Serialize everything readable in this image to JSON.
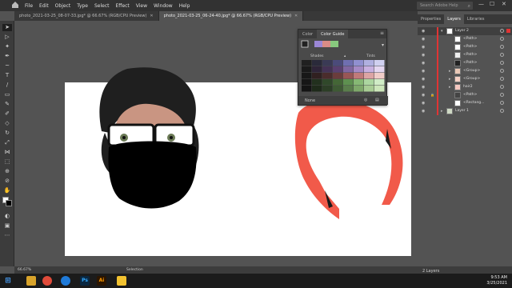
{
  "menubar": {
    "items": [
      "File",
      "Edit",
      "Object",
      "Type",
      "Select",
      "Effect",
      "View",
      "Window",
      "Help"
    ],
    "search_placeholder": "Search Adobe Help"
  },
  "tabs": [
    {
      "label": "photo_2021-03-25_08-07-33.jpg* @ 66.67% (RGB/CPU Preview)",
      "active": false
    },
    {
      "label": "photo_2021-03-25_06-24-40.jpg* @ 66.67% (RGB/CPU Preview)",
      "active": true
    }
  ],
  "color_guide": {
    "tabs": [
      "Color",
      "Color Guide"
    ],
    "shades_label": "Shades",
    "tints_label": "Tints",
    "none_label": "None",
    "harmony_swatches": [
      "#9b87d6",
      "#d98c86",
      "#88c97e"
    ],
    "grid": [
      [
        "#202020",
        "#2a2a3a",
        "#3a3a55",
        "#4b4b7a",
        "#6f6fb0",
        "#9090d0",
        "#b0b0e0",
        "#d0d0f0"
      ],
      [
        "#1a1a1a",
        "#2e2438",
        "#443255",
        "#5a4070",
        "#8066a0",
        "#a58ac5",
        "#c8b0e0",
        "#e4d6f0"
      ],
      [
        "#181818",
        "#302020",
        "#4a2c2c",
        "#6a3c3c",
        "#985656",
        "#c07a7a",
        "#dca4a4",
        "#f0ccc8"
      ],
      [
        "#161616",
        "#22301e",
        "#30482a",
        "#446636",
        "#5e9050",
        "#86b874",
        "#acd6a0",
        "#d0ecc6"
      ],
      [
        "#141414",
        "#1e2a1a",
        "#2c3e26",
        "#3e5a34",
        "#5a7e4c",
        "#7ea86a",
        "#a8cc94",
        "#cce6ba"
      ]
    ]
  },
  "panels": {
    "tabs": [
      "Properties",
      "Layers",
      "Libraries"
    ],
    "active_tab": "Layers"
  },
  "layers": [
    {
      "name": "Layer 2",
      "level": 0,
      "expanded": true,
      "thumb": "#fff",
      "selected": true
    },
    {
      "name": "<Path>",
      "level": 1,
      "thumb": "#fff"
    },
    {
      "name": "<Path>",
      "level": 1,
      "thumb": "#fff"
    },
    {
      "name": "<Path>",
      "level": 1,
      "thumb": "#eee"
    },
    {
      "name": "<Path>",
      "level": 1,
      "thumb": "#222"
    },
    {
      "name": "<Group>",
      "level": 1,
      "group": true,
      "thumb": "#e9c8b6"
    },
    {
      "name": "<Group>",
      "level": 1,
      "group": true,
      "thumb": "#f4d0c4"
    },
    {
      "name": "hair2",
      "level": 1,
      "group": true,
      "thumb": "#f5c8c0"
    },
    {
      "name": "<Path>",
      "level": 1,
      "locked": true,
      "thumb": "#444"
    },
    {
      "name": "<Rectang...",
      "level": 1,
      "thumb": "#fff"
    },
    {
      "name": "Layer 1",
      "level": 0,
      "expanded": false,
      "thumb": "#cfd9c4"
    }
  ],
  "layers_footer": "2 Layers",
  "status": {
    "zoom": "66.67%",
    "tool": "Selection"
  },
  "taskbar": {
    "time": "9:53 AM",
    "date": "3/25/2021"
  },
  "colors": {
    "accent": "#e03434",
    "hair": "#f15a4a",
    "skin": "#c99582",
    "mask": "#000000"
  }
}
